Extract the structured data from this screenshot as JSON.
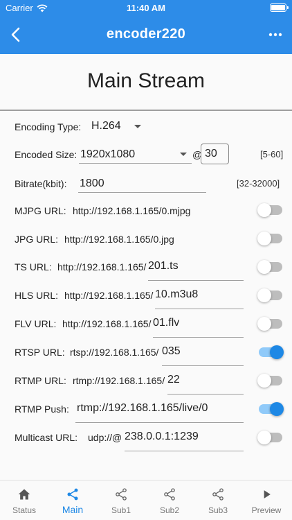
{
  "status": {
    "carrier": "Carrier",
    "time": "11:40 AM"
  },
  "appbar": {
    "title": "encoder220"
  },
  "page": {
    "heading": "Main Stream"
  },
  "encoding": {
    "label": "Encoding Type:",
    "value": "H.264"
  },
  "size": {
    "label": "Encoded Size:",
    "value": "1920x1080",
    "at": "@",
    "fps": "30",
    "range": "[5-60]"
  },
  "bitrate": {
    "label": "Bitrate(kbit):",
    "value": "1800",
    "range": "[32-32000]"
  },
  "urls": [
    {
      "label": "MJPG URL:",
      "value": "http://192.168.1.165/0.mjpg",
      "enabled": false
    },
    {
      "label": "JPG URL:",
      "value": "http://192.168.1.165/0.jpg",
      "enabled": false
    },
    {
      "label": "TS URL:",
      "prefix": "http://192.168.1.165/",
      "suffix": "201.ts",
      "enabled": false
    },
    {
      "label": "HLS URL:",
      "prefix": "http://192.168.1.165/",
      "suffix": "10.m3u8",
      "enabled": false
    },
    {
      "label": "FLV URL:",
      "prefix": "http://192.168.1.165/",
      "suffix": "01.flv",
      "enabled": false
    },
    {
      "label": "RTSP URL:",
      "prefix": "rtsp://192.168.1.165/",
      "suffix": "035",
      "enabled": true
    },
    {
      "label": "RTMP URL:",
      "prefix": "rtmp://192.168.1.165/",
      "suffix": "22",
      "enabled": false
    },
    {
      "label": "RTMP Push:",
      "value": "rtmp://192.168.1.165/live/0",
      "enabled": true
    },
    {
      "label": "Multicast URL:",
      "prefix": "udp://@",
      "suffix": "238.0.0.1:1239",
      "enabled": false
    }
  ],
  "tabs": [
    {
      "label": "Status",
      "icon": "home-icon"
    },
    {
      "label": "Main",
      "icon": "share-icon",
      "active": true
    },
    {
      "label": "Sub1",
      "icon": "share-icon"
    },
    {
      "label": "Sub2",
      "icon": "share-icon"
    },
    {
      "label": "Sub3",
      "icon": "share-icon"
    },
    {
      "label": "Preview",
      "icon": "play-icon"
    }
  ],
  "colors": {
    "primary": "#2d8ce8",
    "accent": "#1e88e5",
    "divider": "#9e9e9e"
  }
}
